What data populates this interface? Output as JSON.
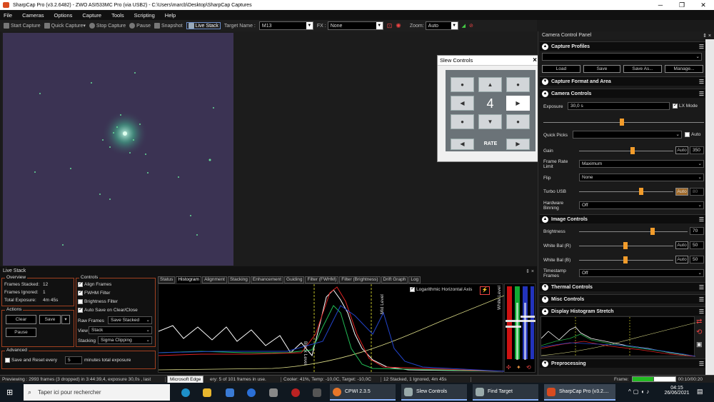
{
  "window": {
    "title": "SharpCap Pro (v3.2.6482) - ZWO ASI533MC Pro (via USB2) - C:\\Users\\marcb\\Desktop\\SharpCap Captures"
  },
  "menu": [
    "File",
    "Cameras",
    "Options",
    "Capture",
    "Tools",
    "Scripting",
    "Help"
  ],
  "toolbar": {
    "start_capture": "Start Capture",
    "quick_capture": "Quick Capture",
    "stop_capture": "Stop Capture",
    "pause": "Pause",
    "snapshot": "Snapshot",
    "live_stack": "Live Stack",
    "target_name_label": "Target Name :",
    "target_name_value": "M13",
    "fx_label": "FX :",
    "fx_value": "None",
    "zoom_label": "Zoom:",
    "zoom_value": "Auto"
  },
  "slew": {
    "title": "Slew Controls",
    "rate_value": "4",
    "rate_label": "RATE",
    "close": "×"
  },
  "right_panel": {
    "title": "Camera Control Panel",
    "pin": "⇕ ×",
    "capture_profiles": "Capture Profiles",
    "load": "Load",
    "save": "Save",
    "save_as": "Save As...",
    "manage": "Manage...",
    "capture_format": "Capture Format and Area",
    "camera_controls": "Camera Controls",
    "exposure_label": "Exposure",
    "exposure_value": "30,0 s",
    "lx_mode": "LX Mode",
    "quick_picks": "Quick Picks",
    "auto": "Auto",
    "gain_label": "Gain",
    "gain_auto": "Auto",
    "gain_value": "350",
    "frame_rate_label": "Frame Rate Limit",
    "frame_rate_value": "Maximum",
    "flip_label": "Flip",
    "flip_value": "None",
    "turbo_label": "Turbo USB",
    "turbo_auto": "Auto",
    "turbo_value": "80",
    "binning_label": "Hardware Binning",
    "binning_value": "Off",
    "image_controls": "Image Controls",
    "brightness_label": "Brightness",
    "brightness_value": "70",
    "wb_r_label": "White Bal (R)",
    "wb_r_auto": "Auto",
    "wb_r_value": "50",
    "wb_b_label": "White Bal (B)",
    "wb_b_auto": "Auto",
    "wb_b_value": "50",
    "timestamp_label": "Timestamp Frames",
    "timestamp_value": "Off",
    "thermal": "Thermal Controls",
    "misc": "Misc Controls",
    "display_hist": "Display Histogram Stretch",
    "preprocessing": "Preprocessing"
  },
  "live_stack": {
    "title": "Live Stack",
    "overview": "Overview",
    "frames_stacked_label": "Frames Stacked:",
    "frames_stacked": "12",
    "frames_ignored_label": "Frames Ignored:",
    "frames_ignored": "1",
    "total_exposure_label": "Total Exposure:",
    "total_exposure": "4m 45s",
    "actions": "Actions",
    "clear": "Clear",
    "save": "Save",
    "pause": "Pause",
    "advanced": "Advanced",
    "save_reset_label": "Save and Reset every",
    "save_reset_value": "5",
    "save_reset_suffix": "minutes total exposure",
    "controls": "Controls",
    "align_frames": "Align Frames",
    "fwhm_filter": "FWHM Filter",
    "brightness_filter": "Brightness Filter",
    "auto_save": "Auto Save on Clear/Close",
    "raw_frames_label": "Raw Frames",
    "raw_frames_value": "Save Stacked",
    "view_label": "View",
    "view_value": "Stack",
    "stacking_label": "Stacking",
    "stacking_value": "Sigma Clipping",
    "tabs": [
      "Status",
      "Histogram",
      "Alignment",
      "Stacking",
      "Enhancement",
      "Guiding",
      "Filter (FWHM)",
      "Filter (Brightness)",
      "Drift Graph",
      "Log"
    ],
    "log_axis": "Logarithmic Horizontal Axis",
    "black_level": "Black Level",
    "mid_level": "Mid Level",
    "white_level": "White Level"
  },
  "status": {
    "preview": "Previewing : 2993 frames (3 dropped) in 3:44:39,4, exposure 30,0s , last",
    "history": "ery: 5 of 101 frames in use.",
    "cooler": "Cooler: 41%, Temp: -10,0C, Target: -10,0C",
    "stack": "12 Stacked, 1 Ignored, 4m 45s",
    "frame_label": "Frame:",
    "time": "00:10/00:20"
  },
  "tooltip": "Microsoft Edge",
  "taskbar": {
    "search": "Taper ici pour rechercher",
    "cpwi": "CPWI 2.3.5",
    "slew": "Slew Controls",
    "find": "Find Target",
    "sharpcap": "SharpCap Pro (v3.2....",
    "clock_time": "04:15",
    "clock_date": "26/06/2021"
  }
}
